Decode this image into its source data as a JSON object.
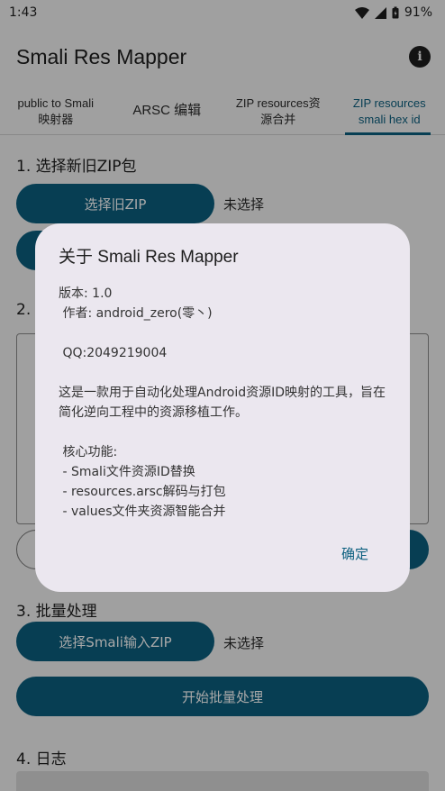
{
  "status_bar": {
    "time": "1:43",
    "battery": "91%"
  },
  "app_bar": {
    "title": "Smali Res Mapper"
  },
  "tabs": [
    {
      "line1": "public to Smali",
      "line2": "映射器"
    },
    {
      "line1": "ARSC 编辑",
      "line2": ""
    },
    {
      "line1": "ZIP resources资",
      "line2": "源合并"
    },
    {
      "line1": "ZIP resources",
      "line2": "smali hex id"
    }
  ],
  "section1": {
    "title": "1. 选择新旧ZIP包",
    "select_old_label": "选择旧ZIP",
    "old_status": "未选择"
  },
  "section2": {
    "title": "2."
  },
  "section3": {
    "title": "3. 批量处理",
    "select_input_label": "选择Smali输入ZIP",
    "input_status": "未选择",
    "start_label": "开始批量处理"
  },
  "section4": {
    "title": "4. 日志"
  },
  "dialog": {
    "title": "关于 Smali Res Mapper",
    "version": "版本: 1.0",
    "author": " 作者: android_zero(零丶)",
    "qq": " QQ:2049219004",
    "description": " 这是一款用于自动化处理Android资源ID映射的工具，旨在简化逆向工程中的资源移植工作。",
    "features_title": " 核心功能:",
    "features": [
      " - Smali文件资源ID替换",
      " - resources.arsc解码与打包",
      " - values文件夹资源智能合并"
    ],
    "ok_label": "确定"
  }
}
